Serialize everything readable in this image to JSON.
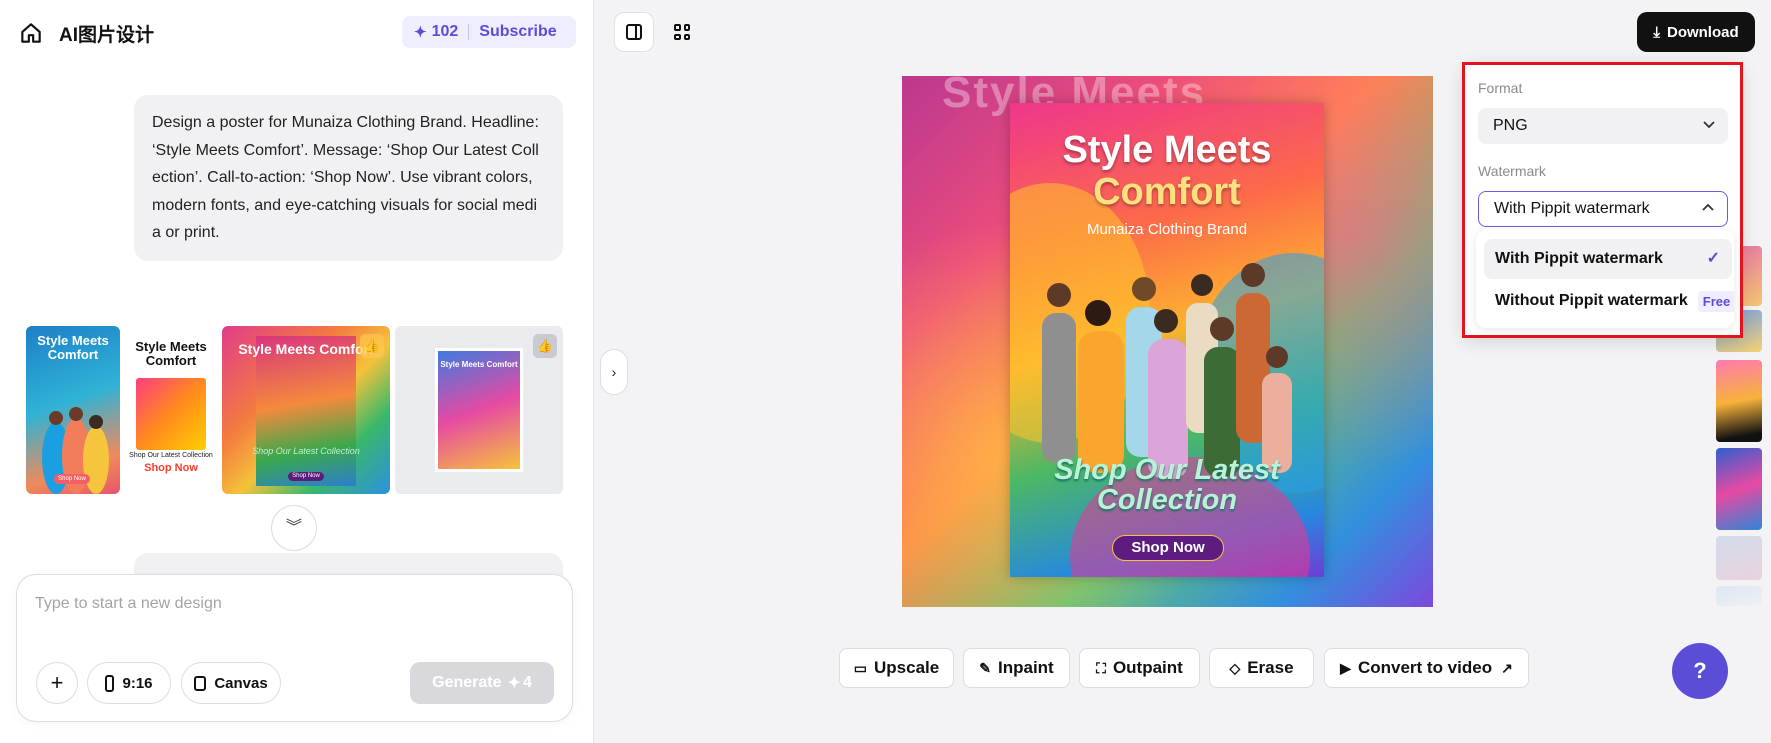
{
  "header": {
    "app_title": "AI图片设计",
    "credits": "102",
    "subscribe_label": "Subscribe"
  },
  "chat": {
    "prompt": "Design a poster for Munaiza Clothing Brand. Headline: ‘Style Meets Comfort’. Message: ‘Shop Our Latest Collection’. Call-to-action: ‘Shop Now’. Use vibrant colors, modern fonts, and eye-catching visuals for social media or print.",
    "thumbnails": [
      {
        "title": "Style Meets Comfort",
        "cta": "Shop Now"
      },
      {
        "title": "Style Meets Comfort",
        "sub": "Shop Our Latest Collection",
        "cta": "Shop Now"
      },
      {
        "title": "Style Meets Comfort",
        "sub": "Shop Our Latest Collection",
        "cta": "Shop Now"
      },
      {
        "title": "Style Meets Comfort"
      }
    ]
  },
  "composer": {
    "placeholder": "Type to start a new design",
    "ratio": "9:16",
    "canvas": "Canvas",
    "generate": "Generate",
    "generate_cost": "4"
  },
  "poster": {
    "title_line1": "Style Meets",
    "title_line2": "Comfort",
    "brand": "Munaiza Clothing Brand",
    "shop_line1": "Shop Our Latest",
    "shop_line2": "Collection",
    "cta": "Shop Now"
  },
  "toolbar": {
    "download": "Download"
  },
  "download_menu": {
    "format_label": "Format",
    "format_value": "PNG",
    "watermark_label": "Watermark",
    "watermark_value": "With Pippit watermark",
    "options": [
      {
        "label": "With Pippit watermark",
        "selected": true
      },
      {
        "label": "Without Pippit watermark",
        "badge": "Free t"
      }
    ]
  },
  "actions": [
    {
      "label": "Upscale",
      "icon": "hd-icon"
    },
    {
      "label": "Inpaint",
      "icon": "brush-icon"
    },
    {
      "label": "Outpaint",
      "icon": "expand-icon"
    },
    {
      "label": "Erase",
      "icon": "eraser-icon"
    },
    {
      "label": "Convert to video",
      "icon": "video-icon"
    }
  ],
  "colors": {
    "accent": "#5b4dd6",
    "highlight_box": "#e3141c"
  }
}
